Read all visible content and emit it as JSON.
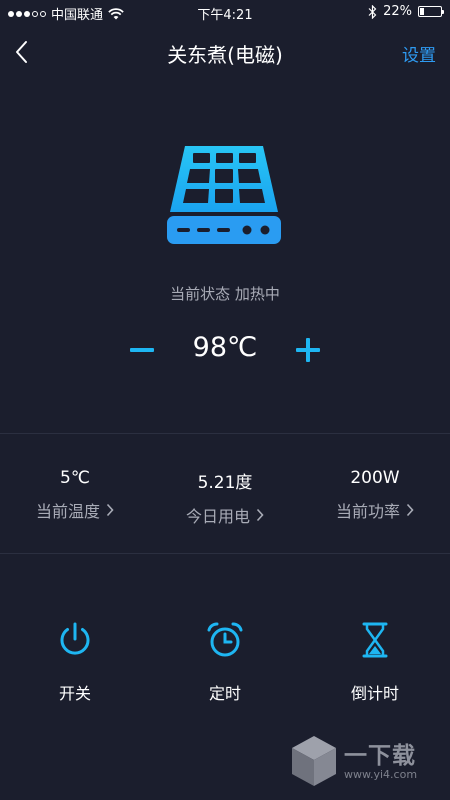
{
  "status_bar": {
    "carrier": "中国联通",
    "time": "下午4:21",
    "battery": "22%",
    "battery_level": 0.22
  },
  "nav": {
    "title": "关东煮(电磁)",
    "settings_label": "设置"
  },
  "device": {
    "status_text": "当前状态 加热中",
    "target_temp": "98℃"
  },
  "stats": [
    {
      "value": "5℃",
      "label": "当前温度"
    },
    {
      "value": "5.21度",
      "label": "今日用电"
    },
    {
      "value": "200W",
      "label": "当前功率"
    }
  ],
  "controls": [
    {
      "label": "开关",
      "icon": "power-icon"
    },
    {
      "label": "定时",
      "icon": "alarm-clock-icon"
    },
    {
      "label": "倒计时",
      "icon": "hourglass-icon"
    }
  ],
  "watermark": {
    "text": "一下载",
    "url": "www.yi4.com"
  },
  "colors": {
    "background": "#1b1e2d",
    "accent": "#2e9bf2",
    "icon_cyan": "#1eb6f2",
    "secondary_text": "#a8abb6"
  }
}
